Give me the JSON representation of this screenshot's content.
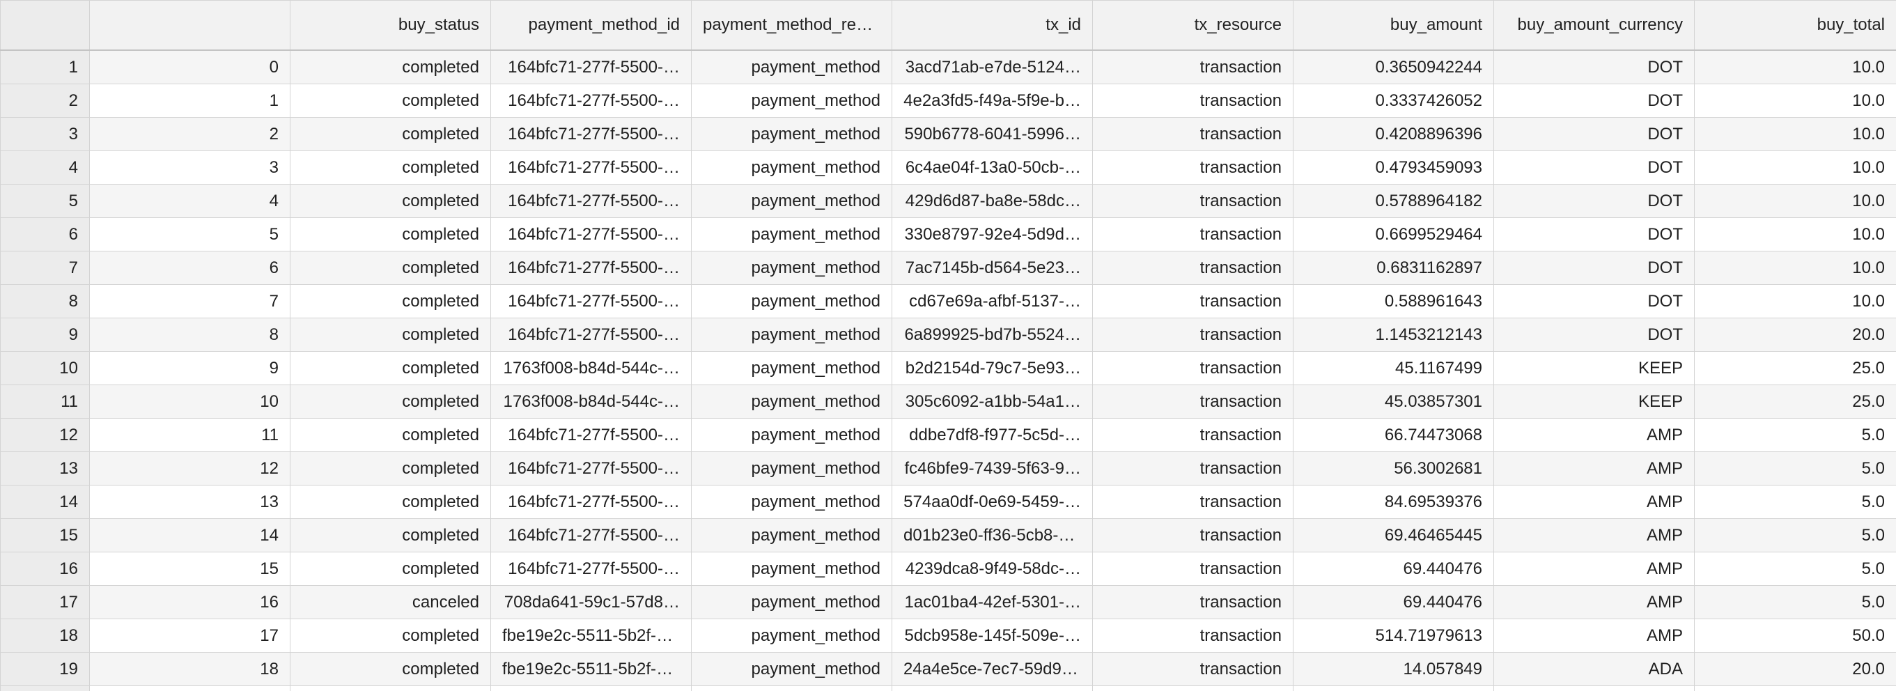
{
  "table": {
    "columns": [
      "",
      "",
      "buy_status",
      "payment_method_id",
      "payment_method_res…",
      "tx_id",
      "tx_resource",
      "buy_amount",
      "buy_amount_currency",
      "buy_total"
    ],
    "rows": [
      [
        "1",
        "0",
        "completed",
        "164bfc71-277f-5500-…",
        "payment_method",
        "3acd71ab-e7de-5124…",
        "transaction",
        "0.3650942244",
        "DOT",
        "10.0"
      ],
      [
        "2",
        "1",
        "completed",
        "164bfc71-277f-5500-…",
        "payment_method",
        "4e2a3fd5-f49a-5f9e-b…",
        "transaction",
        "0.3337426052",
        "DOT",
        "10.0"
      ],
      [
        "3",
        "2",
        "completed",
        "164bfc71-277f-5500-…",
        "payment_method",
        "590b6778-6041-5996…",
        "transaction",
        "0.4208896396",
        "DOT",
        "10.0"
      ],
      [
        "4",
        "3",
        "completed",
        "164bfc71-277f-5500-…",
        "payment_method",
        "6c4ae04f-13a0-50cb-…",
        "transaction",
        "0.4793459093",
        "DOT",
        "10.0"
      ],
      [
        "5",
        "4",
        "completed",
        "164bfc71-277f-5500-…",
        "payment_method",
        "429d6d87-ba8e-58dc…",
        "transaction",
        "0.5788964182",
        "DOT",
        "10.0"
      ],
      [
        "6",
        "5",
        "completed",
        "164bfc71-277f-5500-…",
        "payment_method",
        "330e8797-92e4-5d9d…",
        "transaction",
        "0.6699529464",
        "DOT",
        "10.0"
      ],
      [
        "7",
        "6",
        "completed",
        "164bfc71-277f-5500-…",
        "payment_method",
        "7ac7145b-d564-5e23…",
        "transaction",
        "0.6831162897",
        "DOT",
        "10.0"
      ],
      [
        "8",
        "7",
        "completed",
        "164bfc71-277f-5500-…",
        "payment_method",
        "cd67e69a-afbf-5137-…",
        "transaction",
        "0.588961643",
        "DOT",
        "10.0"
      ],
      [
        "9",
        "8",
        "completed",
        "164bfc71-277f-5500-…",
        "payment_method",
        "6a899925-bd7b-5524…",
        "transaction",
        "1.1453212143",
        "DOT",
        "20.0"
      ],
      [
        "10",
        "9",
        "completed",
        "1763f008-b84d-544c-…",
        "payment_method",
        "b2d2154d-79c7-5e93…",
        "transaction",
        "45.1167499",
        "KEEP",
        "25.0"
      ],
      [
        "11",
        "10",
        "completed",
        "1763f008-b84d-544c-…",
        "payment_method",
        "305c6092-a1bb-54a1…",
        "transaction",
        "45.03857301",
        "KEEP",
        "25.0"
      ],
      [
        "12",
        "11",
        "completed",
        "164bfc71-277f-5500-…",
        "payment_method",
        "ddbe7df8-f977-5c5d-…",
        "transaction",
        "66.74473068",
        "AMP",
        "5.0"
      ],
      [
        "13",
        "12",
        "completed",
        "164bfc71-277f-5500-…",
        "payment_method",
        "fc46bfe9-7439-5f63-9…",
        "transaction",
        "56.3002681",
        "AMP",
        "5.0"
      ],
      [
        "14",
        "13",
        "completed",
        "164bfc71-277f-5500-…",
        "payment_method",
        "574aa0df-0e69-5459-…",
        "transaction",
        "84.69539376",
        "AMP",
        "5.0"
      ],
      [
        "15",
        "14",
        "completed",
        "164bfc71-277f-5500-…",
        "payment_method",
        "d01b23e0-ff36-5cb8-a…",
        "transaction",
        "69.46465445",
        "AMP",
        "5.0"
      ],
      [
        "16",
        "15",
        "completed",
        "164bfc71-277f-5500-…",
        "payment_method",
        "4239dca8-9f49-58dc-…",
        "transaction",
        "69.440476",
        "AMP",
        "5.0"
      ],
      [
        "17",
        "16",
        "canceled",
        "708da641-59c1-57d8…",
        "payment_method",
        "1ac01ba4-42ef-5301-…",
        "transaction",
        "69.440476",
        "AMP",
        "5.0"
      ],
      [
        "18",
        "17",
        "completed",
        "fbe19e2c-5511-5b2f-a…",
        "payment_method",
        "5dcb958e-145f-509e-…",
        "transaction",
        "514.71979613",
        "AMP",
        "50.0"
      ],
      [
        "19",
        "18",
        "completed",
        "fbe19e2c-5511-5b2f-a…",
        "payment_method",
        "24a4e5ce-7ec7-59d9-…",
        "transaction",
        "14.057849",
        "ADA",
        "20.0"
      ],
      [
        "",
        "",
        "",
        "",
        "",
        "",
        "",
        "",
        "",
        ""
      ]
    ]
  }
}
